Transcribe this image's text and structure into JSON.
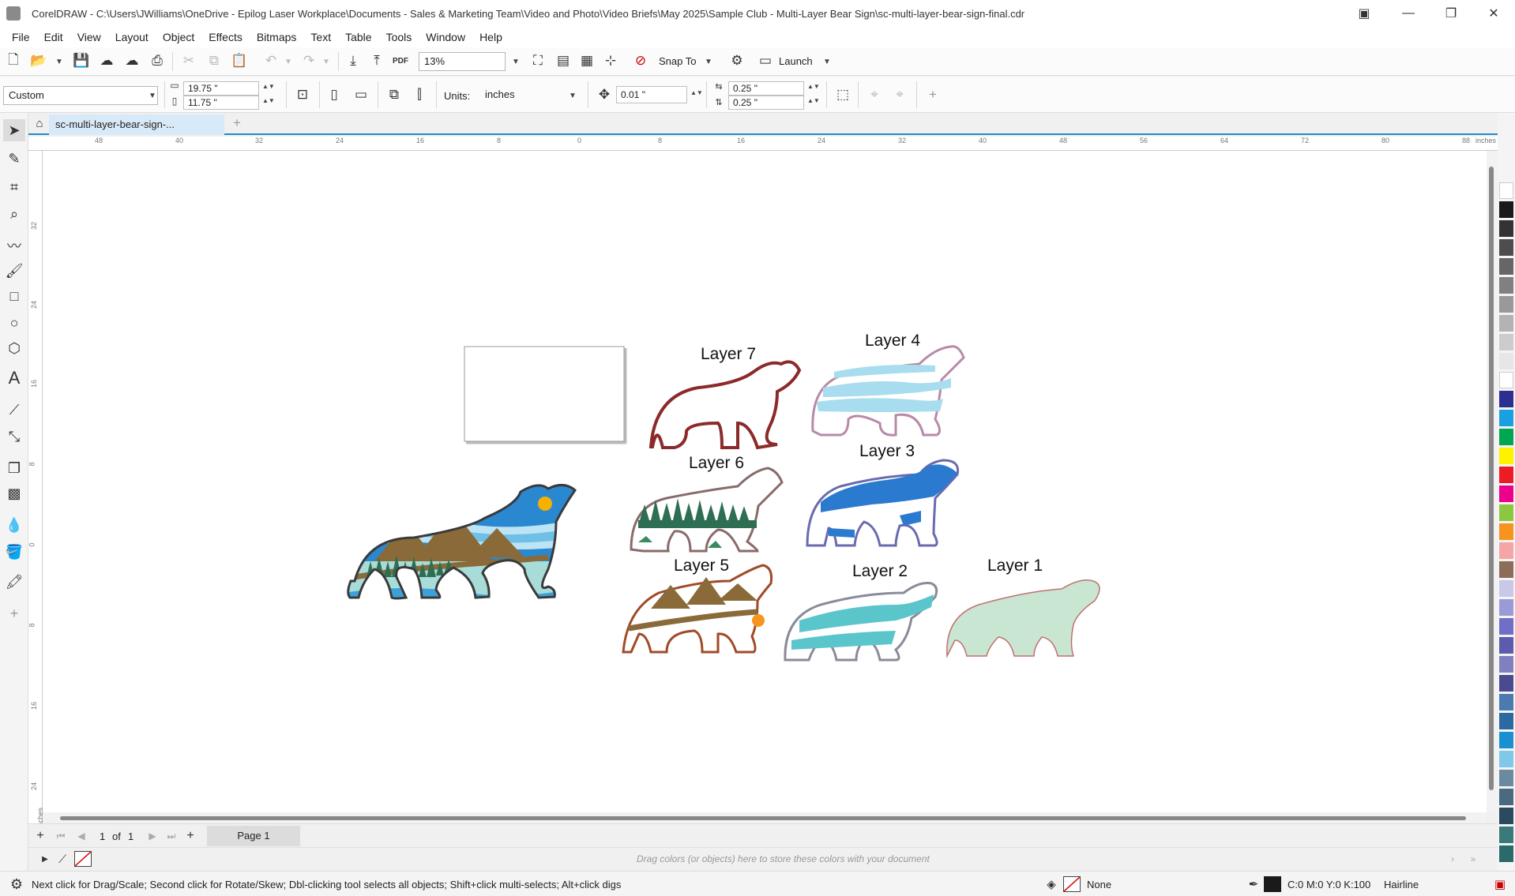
{
  "window": {
    "title": "CorelDRAW - C:\\Users\\JWilliams\\OneDrive - Epilog Laser Workplace\\Documents - Sales & Marketing Team\\Video and Photo\\Video Briefs\\May 2025\\Sample Club - Multi-Layer Bear Sign\\sc-multi-layer-bear-sign-final.cdr",
    "minimize": "—",
    "restore": "❐",
    "close": "✕"
  },
  "menu": [
    "File",
    "Edit",
    "View",
    "Layout",
    "Object",
    "Effects",
    "Bitmaps",
    "Text",
    "Table",
    "Tools",
    "Window",
    "Help"
  ],
  "toolbar": {
    "zoom": "13%",
    "snap_to": "Snap To",
    "launch": "Launch",
    "pdf_label": "PDF"
  },
  "property_bar": {
    "page_size": "Custom",
    "width": "19.75 \"",
    "height": "11.75 \"",
    "units_label": "Units:",
    "units_value": "inches",
    "nudge": "0.01 \"",
    "dup_x": "0.25 \"",
    "dup_y": "0.25 \""
  },
  "document_tab": "sc-multi-layer-bear-sign-...",
  "ruler": {
    "h_ticks": [
      "48",
      "40",
      "32",
      "24",
      "16",
      "8",
      "0",
      "8",
      "16",
      "24",
      "32",
      "40",
      "48",
      "56",
      "64",
      "72",
      "80",
      "88"
    ],
    "h_unit": "inches",
    "v_ticks": [
      "32",
      "24",
      "16",
      "8",
      "0",
      "8",
      "16",
      "24"
    ],
    "v_unit": "inches"
  },
  "canvas": {
    "layers": {
      "layer7": "Layer 7",
      "layer4": "Layer 4",
      "layer6": "Layer 6",
      "layer3": "Layer 3",
      "layer5": "Layer 5",
      "layer2": "Layer 2",
      "layer1": "Layer 1"
    }
  },
  "page_nav": {
    "current": "1",
    "of_label": "of",
    "total": "1",
    "page_tab": "Page 1"
  },
  "color_dock_hint": "Drag colors (or objects) here to store these colors with your document",
  "status": {
    "hint": "Next click for Drag/Scale; Second click for Rotate/Skew; Dbl-clicking tool selects all objects; Shift+click multi-selects; Alt+click digs",
    "fill": "None",
    "outline_color": "C:0 M:0 Y:0 K:100",
    "outline_width": "Hairline"
  },
  "palette_colors": [
    "#ffffff",
    "#1a1a1a",
    "#333333",
    "#4d4d4d",
    "#666666",
    "#808080",
    "#999999",
    "#b3b3b3",
    "#cccccc",
    "#e6e6e6",
    "#ffffff",
    "#2b2f8f",
    "#1a9fe0",
    "#00a651",
    "#fff200",
    "#ed1c24",
    "#ec008c",
    "#8dc63f",
    "#f7941d",
    "#f4a6a6",
    "#8c6d5a",
    "#c8c8e8",
    "#9a9ad8",
    "#6f6fc8",
    "#5b5bb0",
    "#8080c0",
    "#4a4a90",
    "#4a7ab0",
    "#2a6aa0",
    "#1a90d0",
    "#80c8e8",
    "#6a8aa0",
    "#4a6a80",
    "#2a4a60",
    "#3a7a7a",
    "#2a6a6a"
  ]
}
